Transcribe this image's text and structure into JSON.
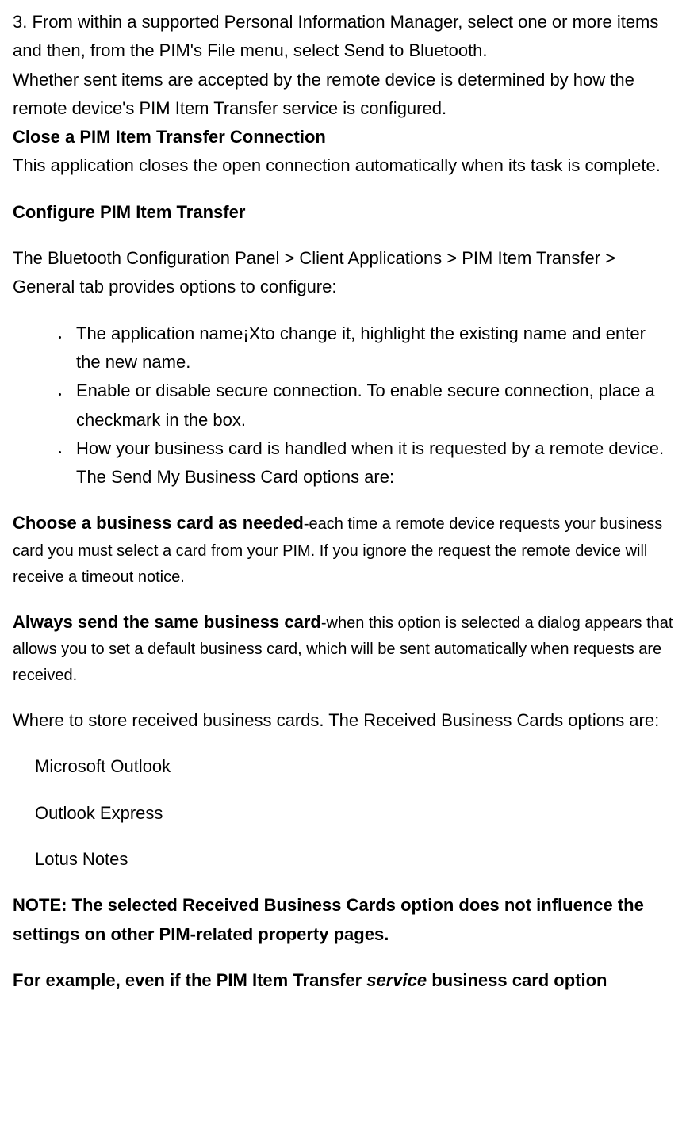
{
  "p1": "3. From within a supported Personal Information Manager, select one or more items and then, from the PIM's File menu, select Send to Bluetooth.",
  "p2": "Whether sent items are accepted by the remote device is determined by how the remote device's PIM Item Transfer service is configured.",
  "h1": "Close a PIM Item Transfer Connection",
  "p3": "This application closes the open connection automatically when its task is complete.",
  "h2": "Configure PIM Item Transfer",
  "p4": "The Bluetooth Configuration Panel > Client Applications > PIM Item Transfer > General tab provides options to configure:",
  "bullets": {
    "b1": " The application name¡Xto change it, highlight the existing name and enter the new name.",
    "b2": "Enable or disable secure connection. To enable secure connection, place a checkmark in the box.",
    "b3": "How your business card is handled when it is requested by a remote device. The Send My Business Card options are:"
  },
  "choose_bold": "Choose a business card as needed",
  "choose_rest": "-each time a remote device requests your business card you must select a card from your PIM. If you ignore the request the remote device will receive a timeout notice.",
  "always_bold": "Always send the same business card",
  "always_rest": "-when this option is selected a dialog appears that allows you to set a default business card, which will be sent automatically when requests are received.",
  "p5": "Where to store received business cards. The Received Business Cards options are:",
  "opt1": "Microsoft Outlook",
  "opt2": " Outlook Express",
  "opt3": "Lotus Notes",
  "note": "NOTE: The selected Received Business Cards option does not influence the settings on other PIM-related property pages.",
  "ex_a": "For example, even if the PIM Item Transfer ",
  "ex_b": "service",
  "ex_c": " business card option"
}
